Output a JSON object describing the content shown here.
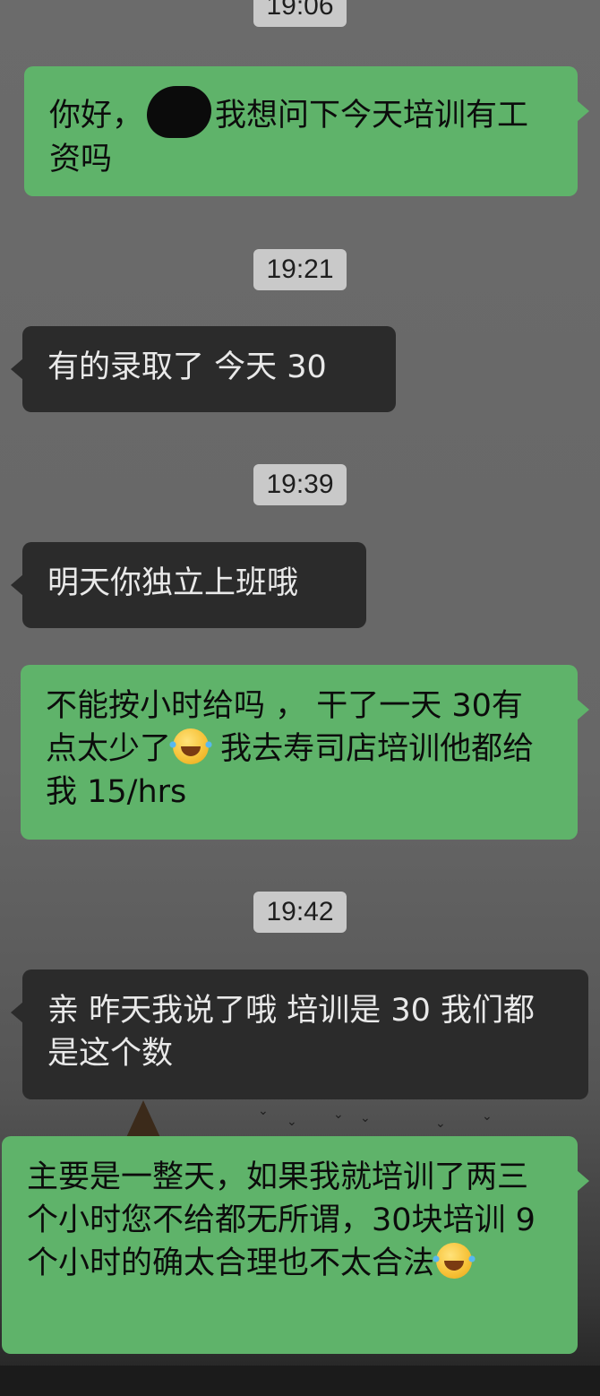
{
  "chat": {
    "timestamps": {
      "t1": "19:06",
      "t2": "19:21",
      "t3": "19:39",
      "t4": "19:42"
    },
    "messages": [
      {
        "side": "outgoing",
        "text_before": "你好，",
        "text_after": "我想问下今天培训有工资吗"
      },
      {
        "side": "incoming",
        "text": "有的录取了 今天 30"
      },
      {
        "side": "incoming",
        "text": "明天你独立上班哦"
      },
      {
        "side": "outgoing",
        "text_before": "不能按小时给吗 ， 干了一天 30有点太少了",
        "emoji": "tears-of-joy-emoji",
        "text_after": " 我去寿司店培训他都给我 15/hrs"
      },
      {
        "side": "incoming",
        "text": "亲 昨天我说了哦 培训是 30 我们都是这个数"
      },
      {
        "side": "outgoing",
        "text_before": "主要是一整天，如果我就培训了两三个小时您不给都无所谓，30块培训 9 个小时的确太合理也不太合法",
        "emoji": "tears-of-joy-emoji"
      }
    ]
  },
  "colors": {
    "outgoing_bubble": "#5fb36a",
    "incoming_bubble": "#2b2b2b",
    "timestamp_bg": "#c9c9c9",
    "background": "#676767"
  }
}
